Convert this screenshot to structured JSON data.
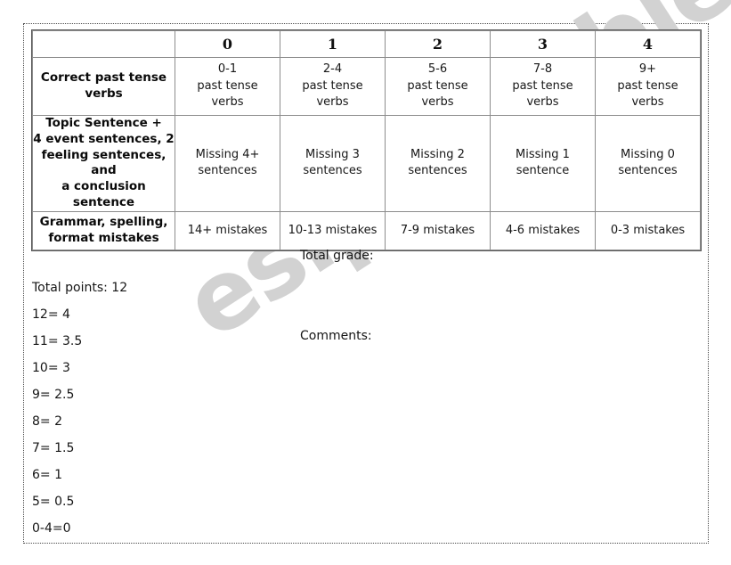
{
  "document": {
    "watermark_text": "eslprintables.com",
    "watermark_color": "#d2d2d2"
  },
  "rubric": {
    "column_headers": [
      "",
      "0",
      "1",
      "2",
      "3",
      "4"
    ],
    "rows": [
      {
        "criterion": "Correct past tense verbs",
        "cells": [
          "0-1\npast tense\nverbs",
          "2-4\npast tense\nverbs",
          "5-6\npast tense\nverbs",
          "7-8\npast tense\nverbs",
          "9+\npast tense\nverbs"
        ]
      },
      {
        "criterion": "Topic Sentence +\n4 event sentences, 2\nfeeling sentences, and\na conclusion sentence",
        "cells": [
          "Missing 4+\nsentences",
          "Missing 3\nsentences",
          "Missing 2\nsentences",
          "Missing 1\nsentence",
          "Missing 0\nsentences"
        ]
      },
      {
        "criterion": "Grammar, spelling,\nformat mistakes",
        "cells": [
          "14+ mistakes",
          "10-13 mistakes",
          "7-9 mistakes",
          "4-6 mistakes",
          "0-3 mistakes"
        ]
      }
    ]
  },
  "fields": {
    "total_grade_label": "Total grade:",
    "comments_label": "Comments:"
  },
  "scale": {
    "lines": [
      "Total points: 12",
      "12= 4",
      "11= 3.5",
      "10= 3",
      "9= 2.5",
      "8= 2",
      "7= 1.5",
      "6= 1",
      "5= 0.5",
      "0-4=0"
    ]
  }
}
